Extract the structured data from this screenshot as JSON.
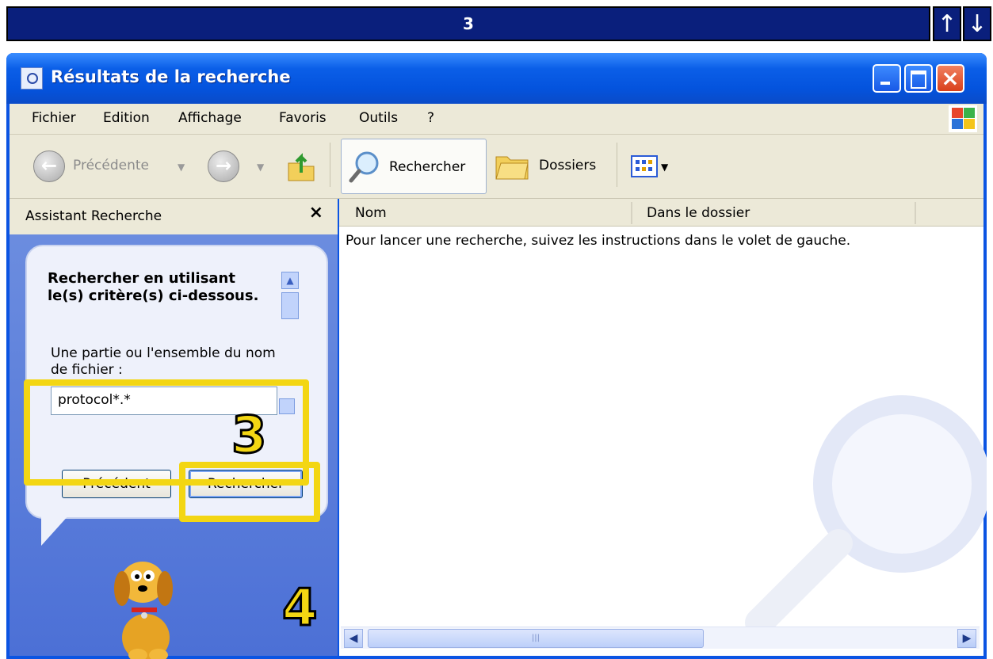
{
  "step_bar": {
    "number": "3",
    "up_arrow": "↑",
    "down_arrow": "↓"
  },
  "window": {
    "title": "Résultats de la recherche",
    "menu": [
      "Fichier",
      "Edition",
      "Affichage",
      "Favoris",
      "Outils",
      "?"
    ],
    "toolbar": {
      "back_label": "Précédente",
      "search_label": "Rechercher",
      "folders_label": "Dossiers"
    },
    "left_pane": {
      "title": "Assistant Recherche",
      "close": "×",
      "heading": "Rechercher en utilisant le(s) critère(s) ci-dessous.",
      "filename_label": "Une partie ou l'ensemble du nom de fichier :",
      "filename_value": "protocol*.*",
      "prev_button": "Précédent",
      "search_button": "Rechercher"
    },
    "columns": [
      "Nom",
      "Dans le dossier"
    ],
    "hint": "Pour lancer une recherche, suivez les instructions dans le volet de gauche."
  },
  "annotations": {
    "step3": "3",
    "step4": "4"
  },
  "colors": {
    "highlight": "#f3d613",
    "title_blue": "#0453dd",
    "step_bar": "#0a1f7c"
  },
  "icons": [
    "arrow-up-icon",
    "arrow-down-icon",
    "search-window-icon",
    "minimize-icon",
    "maximize-icon",
    "close-icon",
    "windows-logo-icon",
    "back-icon",
    "forward-icon",
    "up-folder-icon",
    "magnifier-icon",
    "folders-icon",
    "views-icon",
    "dog-assistant-icon",
    "magnifier-watermark-icon"
  ]
}
